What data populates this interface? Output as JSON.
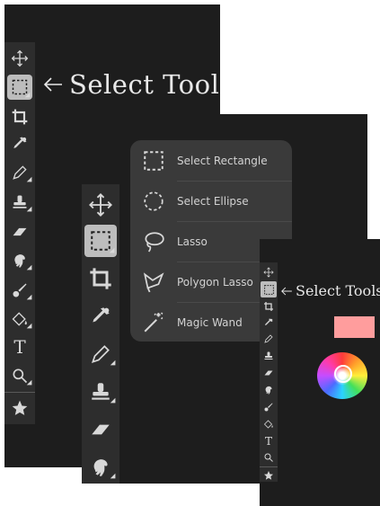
{
  "callout": {
    "label": "Select Tools",
    "arrow": "←"
  },
  "tools": [
    {
      "name": "move-tool",
      "icon": "move-icon"
    },
    {
      "name": "select-tool",
      "icon": "select-rectangle-icon",
      "selected": true
    },
    {
      "name": "crop-tool",
      "icon": "crop-icon"
    },
    {
      "name": "eyedropper-tool",
      "icon": "eyedropper-icon"
    },
    {
      "name": "pencil-tool",
      "icon": "pencil-icon"
    },
    {
      "name": "stamp-tool",
      "icon": "stamp-icon"
    },
    {
      "name": "eraser-tool",
      "icon": "eraser-icon"
    },
    {
      "name": "smudge-tool",
      "icon": "smudge-icon"
    },
    {
      "name": "brush-tool",
      "icon": "brush-icon"
    },
    {
      "name": "fill-tool",
      "icon": "fill-icon"
    },
    {
      "name": "text-tool",
      "icon": "text-icon",
      "glyph": "T"
    },
    {
      "name": "zoom-tool",
      "icon": "zoom-icon"
    },
    {
      "name": "favorites-tool",
      "icon": "star-icon"
    }
  ],
  "select_menu": {
    "items": [
      {
        "label": "Select Rectangle",
        "icon": "select-rectangle-icon"
      },
      {
        "label": "Select Ellipse",
        "icon": "select-ellipse-icon"
      },
      {
        "label": "Lasso",
        "icon": "lasso-icon"
      },
      {
        "label": "Polygon Lasso",
        "icon": "polygon-lasso-icon"
      },
      {
        "label": "Magic Wand",
        "icon": "magic-wand-icon"
      }
    ]
  },
  "colors": {
    "panel_bg": "#1d1d1d",
    "toolbar_bg": "#2d2d2d",
    "selected_tool_bg": "#bdbdbd",
    "menu_bg": "#3a3a3a",
    "primary_swatch": "#ff9d9d"
  }
}
